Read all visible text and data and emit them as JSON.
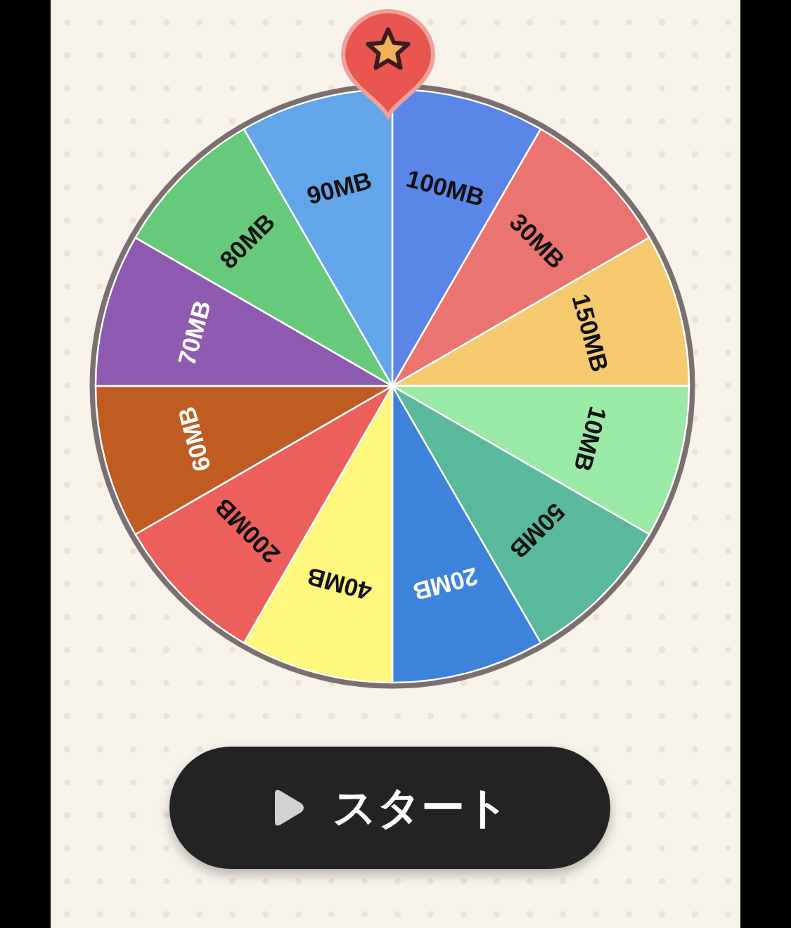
{
  "wheel": {
    "segments": [
      {
        "label": "100MB",
        "color": "#5a86e8",
        "light_label": false
      },
      {
        "label": "30MB",
        "color": "#ec7470",
        "light_label": false
      },
      {
        "label": "150MB",
        "color": "#f5ca6e",
        "light_label": false
      },
      {
        "label": "10MB",
        "color": "#9aeaa6",
        "light_label": false
      },
      {
        "label": "50MB",
        "color": "#5ab99c",
        "light_label": false
      },
      {
        "label": "20MB",
        "color": "#3d83dc",
        "light_label": true
      },
      {
        "label": "40MB",
        "color": "#fff77e",
        "light_label": false
      },
      {
        "label": "200MB",
        "color": "#ec5f5b",
        "light_label": false
      },
      {
        "label": "60MB",
        "color": "#c05b22",
        "light_label": true
      },
      {
        "label": "70MB",
        "color": "#8e5ab0",
        "light_label": true
      },
      {
        "label": "80MB",
        "color": "#67c97a",
        "light_label": false
      },
      {
        "label": "90MB",
        "color": "#62a6e9",
        "light_label": false
      }
    ]
  },
  "start_button": {
    "label": "スタート"
  }
}
